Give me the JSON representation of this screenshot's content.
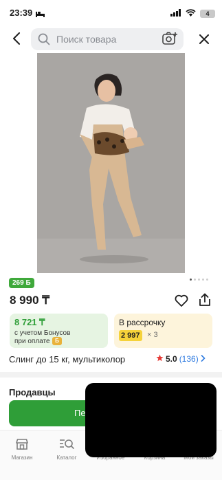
{
  "status_bar": {
    "time": "23:39",
    "battery": "4"
  },
  "search": {
    "placeholder": "Поиск товара"
  },
  "product": {
    "bonus_badge": "269 Б",
    "price": "8 990 ₸",
    "bonus_price": {
      "amount": "8 721 ₸",
      "line1": "с учетом Бонусов",
      "line2": "при оплате",
      "coin": "Б"
    },
    "installment": {
      "label": "В рассрочку",
      "amount": "2 997",
      "times": "× 3"
    },
    "title": "Слинг до 15 кг, мультиколор",
    "rating": {
      "value": "5.0",
      "count": "(136)"
    }
  },
  "sellers": {
    "title": "Продавцы",
    "button_label": "Пе"
  },
  "bottom_nav": {
    "items": [
      {
        "label": "Магазин"
      },
      {
        "label": "Каталог"
      },
      {
        "label": "Избранное"
      },
      {
        "label": "Корзина"
      },
      {
        "label": "Мои заказы"
      }
    ]
  },
  "colors": {
    "brand_green": "#2f9e38",
    "installment_yellow": "#f5d23a",
    "link_blue": "#2f7be0"
  }
}
